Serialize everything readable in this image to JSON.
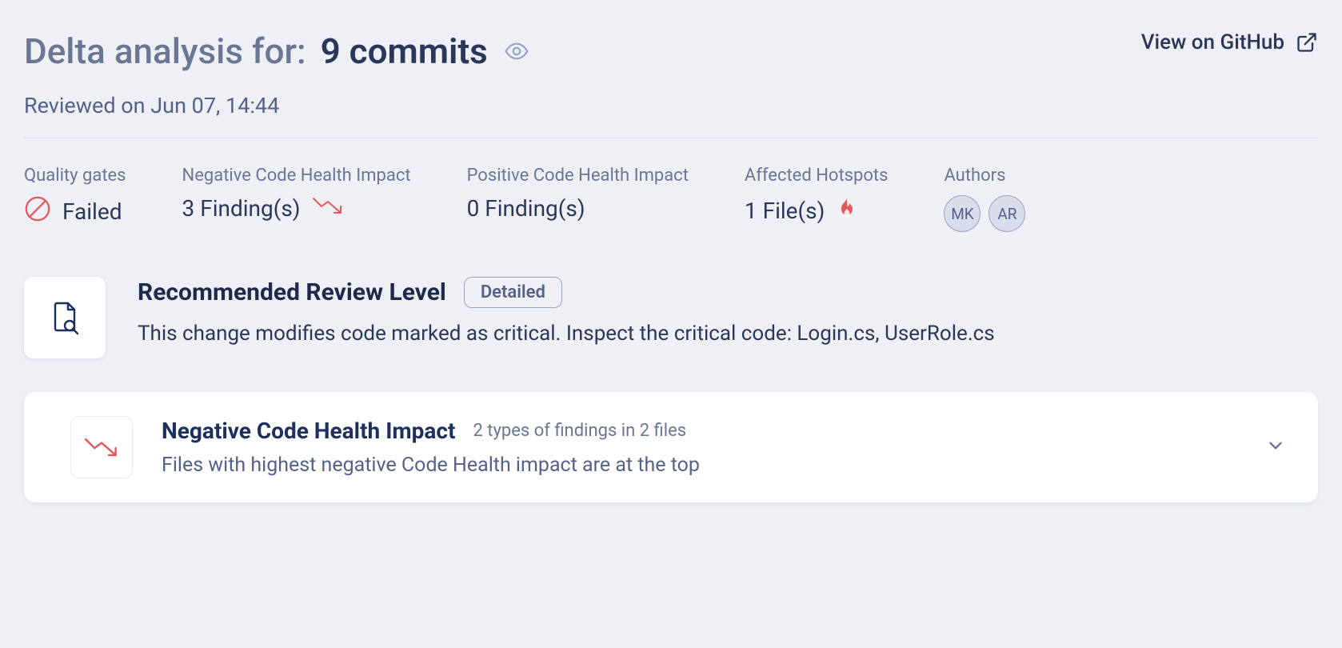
{
  "header": {
    "title_prefix": "Delta analysis for:",
    "title_main": "9 commits",
    "view_on_github": "View on GitHub",
    "reviewed_line": "Reviewed on Jun 07, 14:44"
  },
  "metrics": {
    "quality": {
      "label": "Quality gates",
      "value": "Failed"
    },
    "negative": {
      "label": "Negative Code Health Impact",
      "value": "3 Finding(s)"
    },
    "positive": {
      "label": "Positive Code Health Impact",
      "value": "0 Finding(s)"
    },
    "hotspots": {
      "label": "Affected Hotspots",
      "value": "1 File(s)"
    },
    "authors": {
      "label": "Authors",
      "avatars": [
        "MK",
        "AR"
      ]
    }
  },
  "recommended": {
    "title": "Recommended Review Level",
    "badge": "Detailed",
    "desc": "This change modifies code marked as critical. Inspect the critical code: Login.cs, UserRole.cs"
  },
  "neg_card": {
    "title": "Negative Code Health Impact",
    "meta": "2 types of findings in 2 files",
    "sub": "Files with highest negative Code Health impact are at the top"
  }
}
